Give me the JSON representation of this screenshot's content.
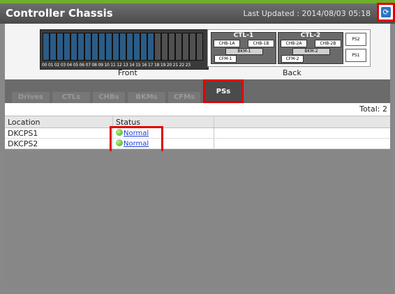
{
  "window": {
    "title": "Controller Chassis",
    "last_updated": "Last Updated : 2014/08/03 05:18"
  },
  "chassis": {
    "front_label": "Front",
    "back_label": "Back",
    "front_slot_numbers": "00 01 02 03 04 05 06 07 08 09 10 11 12 13 14 15 16 17 18 19 20 21 22 23",
    "ctl1": {
      "label": "CTL-1",
      "chb_a": "CHB-1A",
      "chb_b": "CHB-1B",
      "bkm": "BKM-1",
      "cfm": "CFM-1"
    },
    "ctl2": {
      "label": "CTL-2",
      "chb_a": "CHB-2A",
      "chb_b": "CHB-2B",
      "bkm": "BKM-2",
      "cfm": "CFM-2"
    },
    "ps2": "PS2",
    "ps1": "PS1"
  },
  "tabs": [
    {
      "label": "Drives"
    },
    {
      "label": "CTLs"
    },
    {
      "label": "CHBs"
    },
    {
      "label": "BKMs"
    },
    {
      "label": "CFMs"
    },
    {
      "label": "PSs"
    }
  ],
  "active_tab": "PSs",
  "total": "Total: 2",
  "table": {
    "columns": [
      "Location",
      "Status"
    ],
    "rows": [
      {
        "location": "DKCPS1",
        "status": "Normal"
      },
      {
        "location": "DKCPS2",
        "status": "Normal"
      }
    ]
  },
  "colors": {
    "accent_green": "#6fae2a",
    "highlight_red": "#e00000",
    "link_blue": "#1a3fd6",
    "status_normal": "#3aa620"
  },
  "icons": {
    "refresh": "refresh-icon",
    "status": "green-status-dot-icon"
  }
}
